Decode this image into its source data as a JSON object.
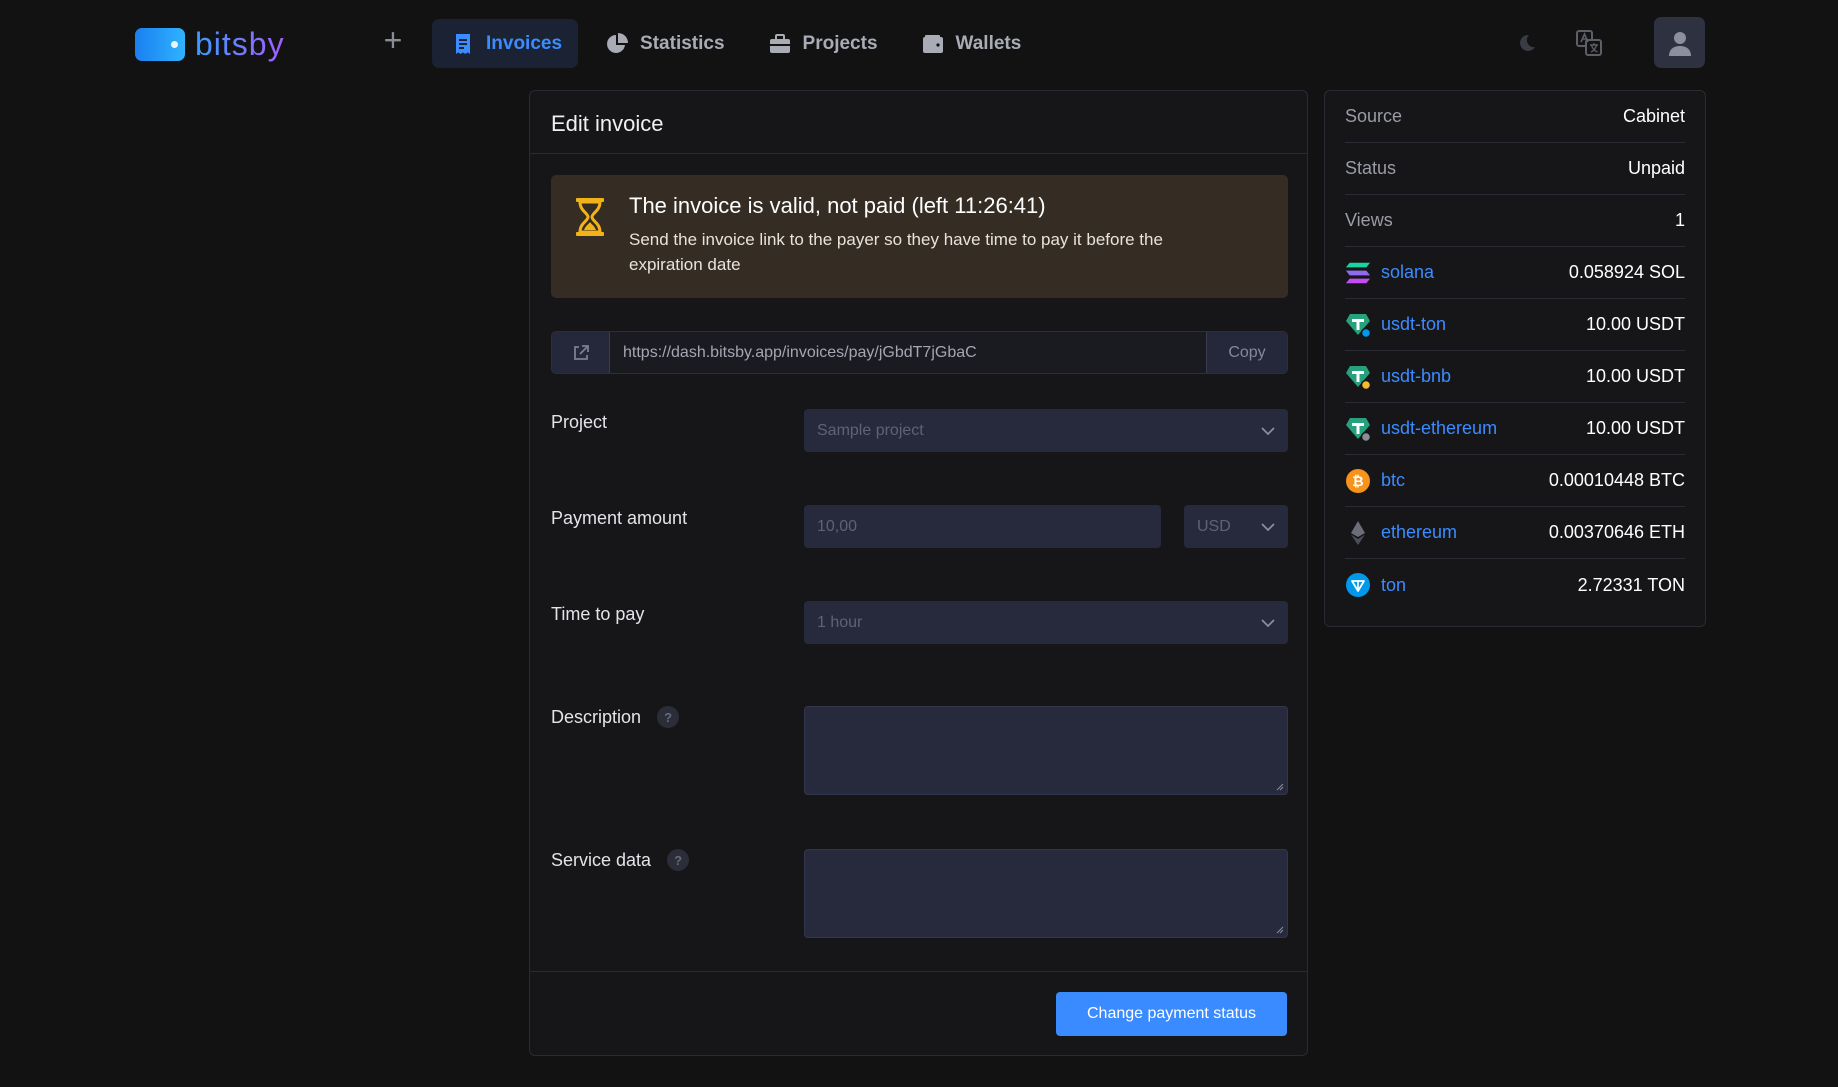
{
  "brand": {
    "name": "bitsby"
  },
  "nav": [
    {
      "label": "Invoices",
      "icon": "receipt-icon",
      "active": true
    },
    {
      "label": "Statistics",
      "icon": "pie-chart-icon",
      "active": false
    },
    {
      "label": "Projects",
      "icon": "briefcase-icon",
      "active": false
    },
    {
      "label": "Wallets",
      "icon": "wallet-icon",
      "active": false
    }
  ],
  "card": {
    "title": "Edit invoice",
    "alert": {
      "title": "The invoice is valid, not paid (left 11:26:41)",
      "text": "Send the invoice link to the payer so they have time to pay it before the expiration date",
      "color": "#f2b318"
    },
    "link": {
      "url": "https://dash.bitsby.app/invoices/pay/jGbdT7jGbaC",
      "copy_label": "Copy"
    },
    "form": {
      "project": {
        "label": "Project",
        "value": "Sample project"
      },
      "amount": {
        "label": "Payment amount",
        "value": "10,00",
        "currency": "USD"
      },
      "time": {
        "label": "Time to pay",
        "value": "1 hour"
      },
      "description": {
        "label": "Description",
        "help": "?"
      },
      "service": {
        "label": "Service data",
        "help": "?"
      }
    },
    "submit_label": "Change payment status"
  },
  "side": {
    "meta": [
      {
        "key": "Source",
        "value": "Cabinet"
      },
      {
        "key": "Status",
        "value": "Unpaid"
      },
      {
        "key": "Views",
        "value": "1"
      }
    ],
    "coins": [
      {
        "name": "solana",
        "amount": "0.058924 SOL",
        "icon": "solana-icon"
      },
      {
        "name": "usdt-ton",
        "amount": "10.00 USDT",
        "icon": "tether-icon"
      },
      {
        "name": "usdt-bnb",
        "amount": "10.00 USDT",
        "icon": "tether-icon"
      },
      {
        "name": "usdt-ethereum",
        "amount": "10.00 USDT",
        "icon": "tether-icon"
      },
      {
        "name": "btc",
        "amount": "0.00010448 BTC",
        "icon": "bitcoin-icon"
      },
      {
        "name": "ethereum",
        "amount": "0.00370646 ETH",
        "icon": "ethereum-icon"
      },
      {
        "name": "ton",
        "amount": "2.72331 TON",
        "icon": "ton-icon"
      }
    ]
  },
  "colors": {
    "accent": "#3b8cff",
    "background": "#121213",
    "alert_bg": "#352c24"
  }
}
